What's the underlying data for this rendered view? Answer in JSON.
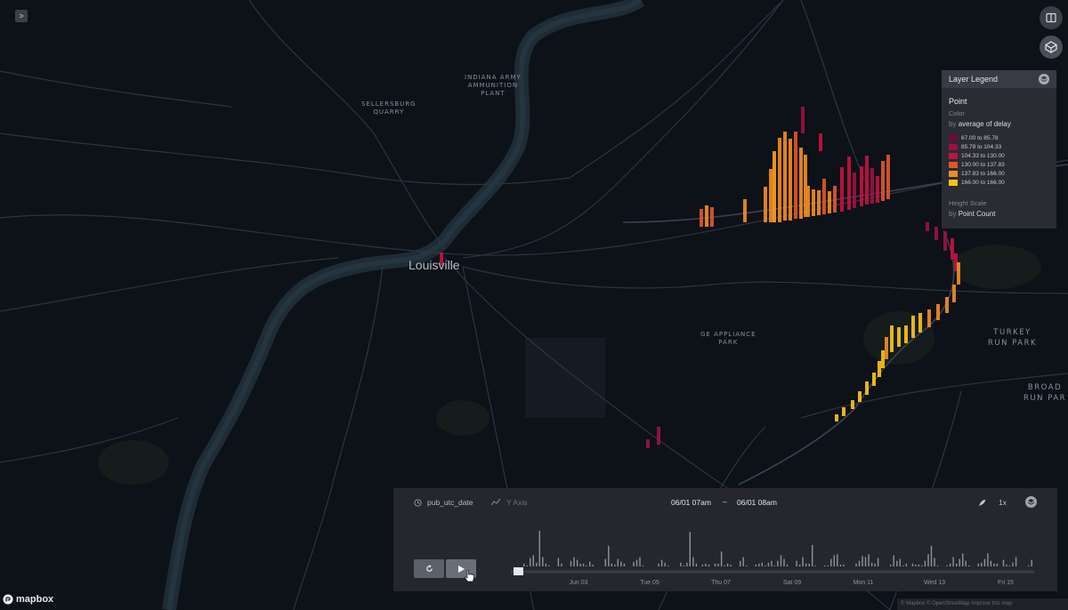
{
  "map": {
    "city_label": "Louisville",
    "places": [
      {
        "label": "INDIANA ARMY\nAMMUNITION\nPLANT",
        "key": "indiana"
      },
      {
        "label": "SELLERSBURG\nQUARRY",
        "key": "sellersburg"
      },
      {
        "label": "GE APPLIANCE\nPARK",
        "key": "ge"
      },
      {
        "label": "TURKEY\nRUN PARK",
        "key": "turkey"
      },
      {
        "label": "BROAD\nRUN PAR",
        "key": "broad"
      }
    ]
  },
  "sidebar_toggle": {
    "icon": "chevron-right-icon",
    "glyph": ">"
  },
  "top_controls": [
    {
      "icon": "split-map-icon"
    },
    {
      "icon": "3d-view-icon"
    }
  ],
  "legend": {
    "header": "Layer Legend",
    "layer_name": "Point",
    "color_label": "Color",
    "color_by_prefix": "by",
    "color_by_field": "average of delay",
    "bins": [
      {
        "label": "67.00 to 85.78",
        "color": "#6e0b3c"
      },
      {
        "label": "85.78 to 104.33",
        "color": "#9d1040"
      },
      {
        "label": "104.33 to 130.00",
        "color": "#c2123f"
      },
      {
        "label": "130.00 to 137.83",
        "color": "#e0562b"
      },
      {
        "label": "137.83 to 166.00",
        "color": "#f08b22"
      },
      {
        "label": "166.00 to 166.00",
        "color": "#f7c21a"
      }
    ],
    "height_label": "Height Scale",
    "height_by_prefix": "by",
    "height_by_field": "Point Count"
  },
  "timeline": {
    "field_name": "pub_utc_date",
    "y_axis_label": "Y Axis",
    "range_start": "06/01 07am",
    "range_separator": "–",
    "range_end": "06/01 08am",
    "speed": "1x",
    "x_ticks": [
      "Jun 03",
      "Tue 05",
      "Thu 07",
      "Sat 09",
      "Mon 11",
      "Wed 13",
      "Fri 15"
    ],
    "histogram": [
      3,
      1,
      9,
      12,
      4,
      38,
      10,
      3,
      1,
      0,
      0,
      9,
      3,
      0,
      0,
      6,
      10,
      7,
      3,
      3,
      1,
      5,
      2,
      0,
      0,
      0,
      8,
      22,
      3,
      2,
      8,
      5,
      3,
      0,
      0,
      5,
      7,
      10,
      1,
      0,
      0,
      0,
      0,
      3,
      7,
      4,
      1,
      0,
      0,
      0,
      4,
      1,
      4,
      37,
      10,
      3,
      0,
      2,
      3,
      2,
      0,
      3,
      3,
      16,
      1,
      3,
      2,
      0,
      0,
      6,
      10,
      1,
      0,
      0,
      2,
      3,
      4,
      1,
      4,
      6,
      1,
      6,
      12,
      8,
      2,
      0,
      0,
      6,
      2,
      10,
      3,
      3,
      23,
      1,
      0,
      0,
      1,
      1,
      8,
      12,
      13,
      2,
      2,
      0,
      0,
      0,
      3,
      6,
      11,
      10,
      13,
      4,
      3,
      9,
      0,
      0,
      0,
      2,
      12,
      6,
      8,
      1,
      3,
      0,
      3,
      2,
      2,
      1,
      6,
      13,
      22,
      9,
      1,
      0,
      0,
      1,
      3,
      10,
      3,
      8,
      14,
      6,
      1,
      0,
      0,
      3,
      4,
      8,
      14,
      6,
      3,
      3,
      0,
      7,
      2,
      1,
      4,
      10,
      0,
      0,
      0,
      1,
      7
    ],
    "playhead_fraction": 0.0,
    "buttons": {
      "reset_icon": "reset-icon",
      "play_icon": "play-icon",
      "speed_icon": "rocket-icon",
      "settings_icon": "settings-icon",
      "field_icon": "clock-icon",
      "axis_icon": "line-chart-icon"
    }
  },
  "branding": {
    "logo_text": "mapbox",
    "attribution": "© Mapbox © OpenStreetMap Improve this map"
  },
  "colors": {
    "background": "#0d1118",
    "panel": "#25272d",
    "accent": "#f7c21a"
  }
}
